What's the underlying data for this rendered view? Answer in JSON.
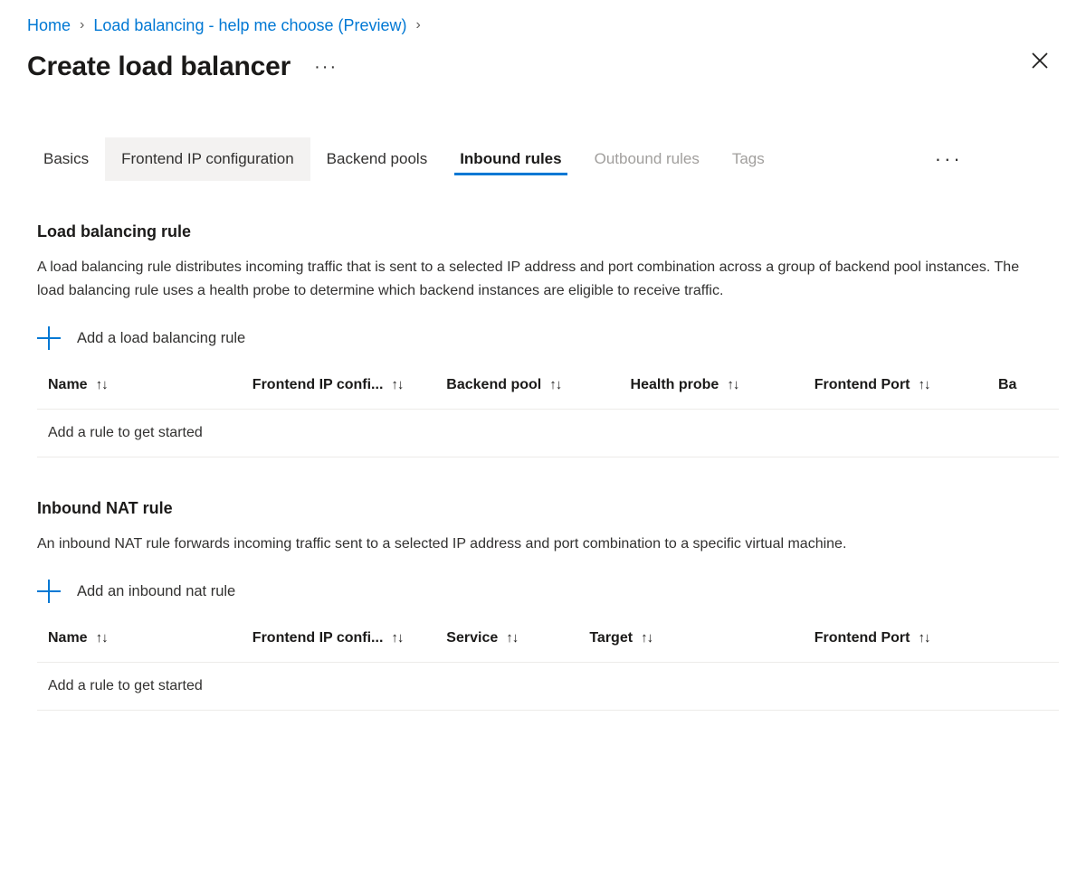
{
  "breadcrumb": {
    "items": [
      {
        "label": "Home"
      },
      {
        "label": "Load balancing - help me choose (Preview)"
      }
    ],
    "separator": "›"
  },
  "header": {
    "title": "Create load balancer",
    "ellipsis": "···",
    "close_icon": "close-icon"
  },
  "tabs": {
    "items": [
      {
        "label": "Basics",
        "state": "normal"
      },
      {
        "label": "Frontend IP configuration",
        "state": "hovered"
      },
      {
        "label": "Backend pools",
        "state": "normal"
      },
      {
        "label": "Inbound rules",
        "state": "active"
      },
      {
        "label": "Outbound rules",
        "state": "disabled"
      },
      {
        "label": "Tags",
        "state": "disabled"
      }
    ],
    "overflow": "···"
  },
  "load_balancing_rule": {
    "heading": "Load balancing rule",
    "description": "A load balancing rule distributes incoming traffic that is sent to a selected IP address and port combination across a group of backend pool instances. The load balancing rule uses a health probe to determine which backend instances are eligible to receive traffic.",
    "add_label": "Add a load balancing rule",
    "add_icon": "plus-icon",
    "sort_icon": "↑↓",
    "columns": [
      {
        "label": "Name",
        "width": "20%"
      },
      {
        "label": "Frontend IP confi...",
        "width": "19%"
      },
      {
        "label": "Backend pool",
        "width": "18%"
      },
      {
        "label": "Health probe",
        "width": "18%"
      },
      {
        "label": "Frontend Port",
        "width": "18%"
      },
      {
        "label": "Ba",
        "width": "7%"
      }
    ],
    "empty_text": "Add a rule to get started"
  },
  "inbound_nat_rule": {
    "heading": "Inbound NAT rule",
    "description": "An inbound NAT rule forwards incoming traffic sent to a selected IP address and port combination to a specific virtual machine.",
    "add_label": "Add an inbound nat rule",
    "add_icon": "plus-icon",
    "sort_icon": "↑↓",
    "columns": [
      {
        "label": "Name",
        "width": "20%"
      },
      {
        "label": "Frontend IP confi...",
        "width": "19%"
      },
      {
        "label": "Service",
        "width": "14%"
      },
      {
        "label": "Target",
        "width": "22%"
      },
      {
        "label": "Frontend Port",
        "width": "25%"
      }
    ],
    "empty_text": "Add a rule to get started"
  },
  "colors": {
    "accent": "#0078d4",
    "text": "#323130",
    "disabled": "#a19f9d",
    "divider": "#edebe9",
    "hover_bg": "#f3f2f1"
  }
}
